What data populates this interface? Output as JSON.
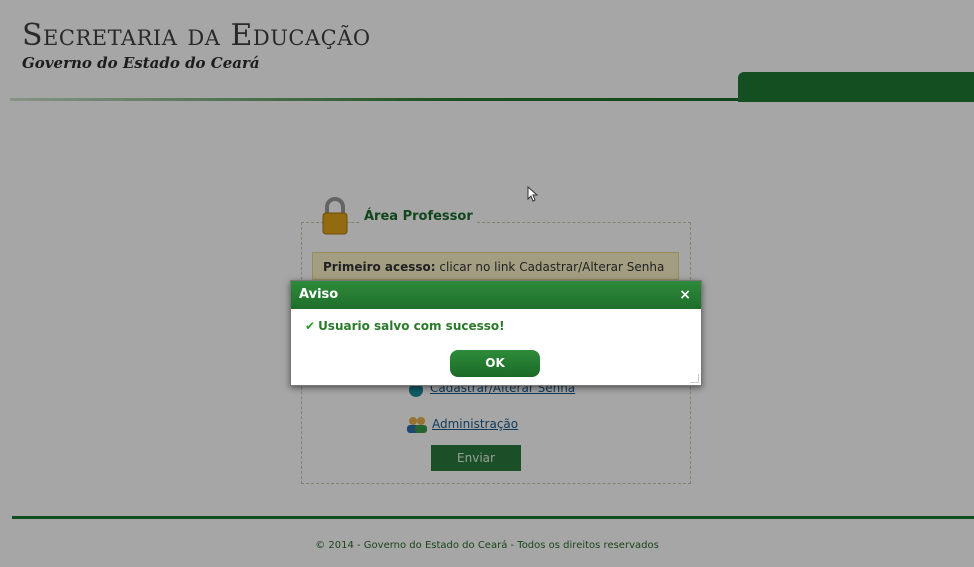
{
  "header": {
    "title": "Secretaria da Educação",
    "subtitle": "Governo do Estado do Ceará"
  },
  "panel": {
    "title": "Área Professor",
    "notice_bold": "Primeiro acesso:",
    "notice_text": " clicar no link Cadastrar/Alterar Senha",
    "links": {
      "password": "Cadastrar/Alterar Senha",
      "admin": "Administração"
    },
    "submit_label": "Enviar"
  },
  "footer": {
    "text": "© 2014 - Governo do Estado do Ceará - Todos os direitos reservados"
  },
  "dialog": {
    "title": "Aviso",
    "close_glyph": "×",
    "message": "Usuario salvo com sucesso!",
    "ok_label": "OK"
  },
  "colors": {
    "brand_green": "#1f7a33",
    "notice_bg": "#fbf3c8"
  },
  "icons": {
    "lock": "lock-icon",
    "key": "key-icon",
    "users": "users-icon",
    "check": "check-icon",
    "close": "close-icon",
    "cursor": "mouse-cursor-icon"
  }
}
